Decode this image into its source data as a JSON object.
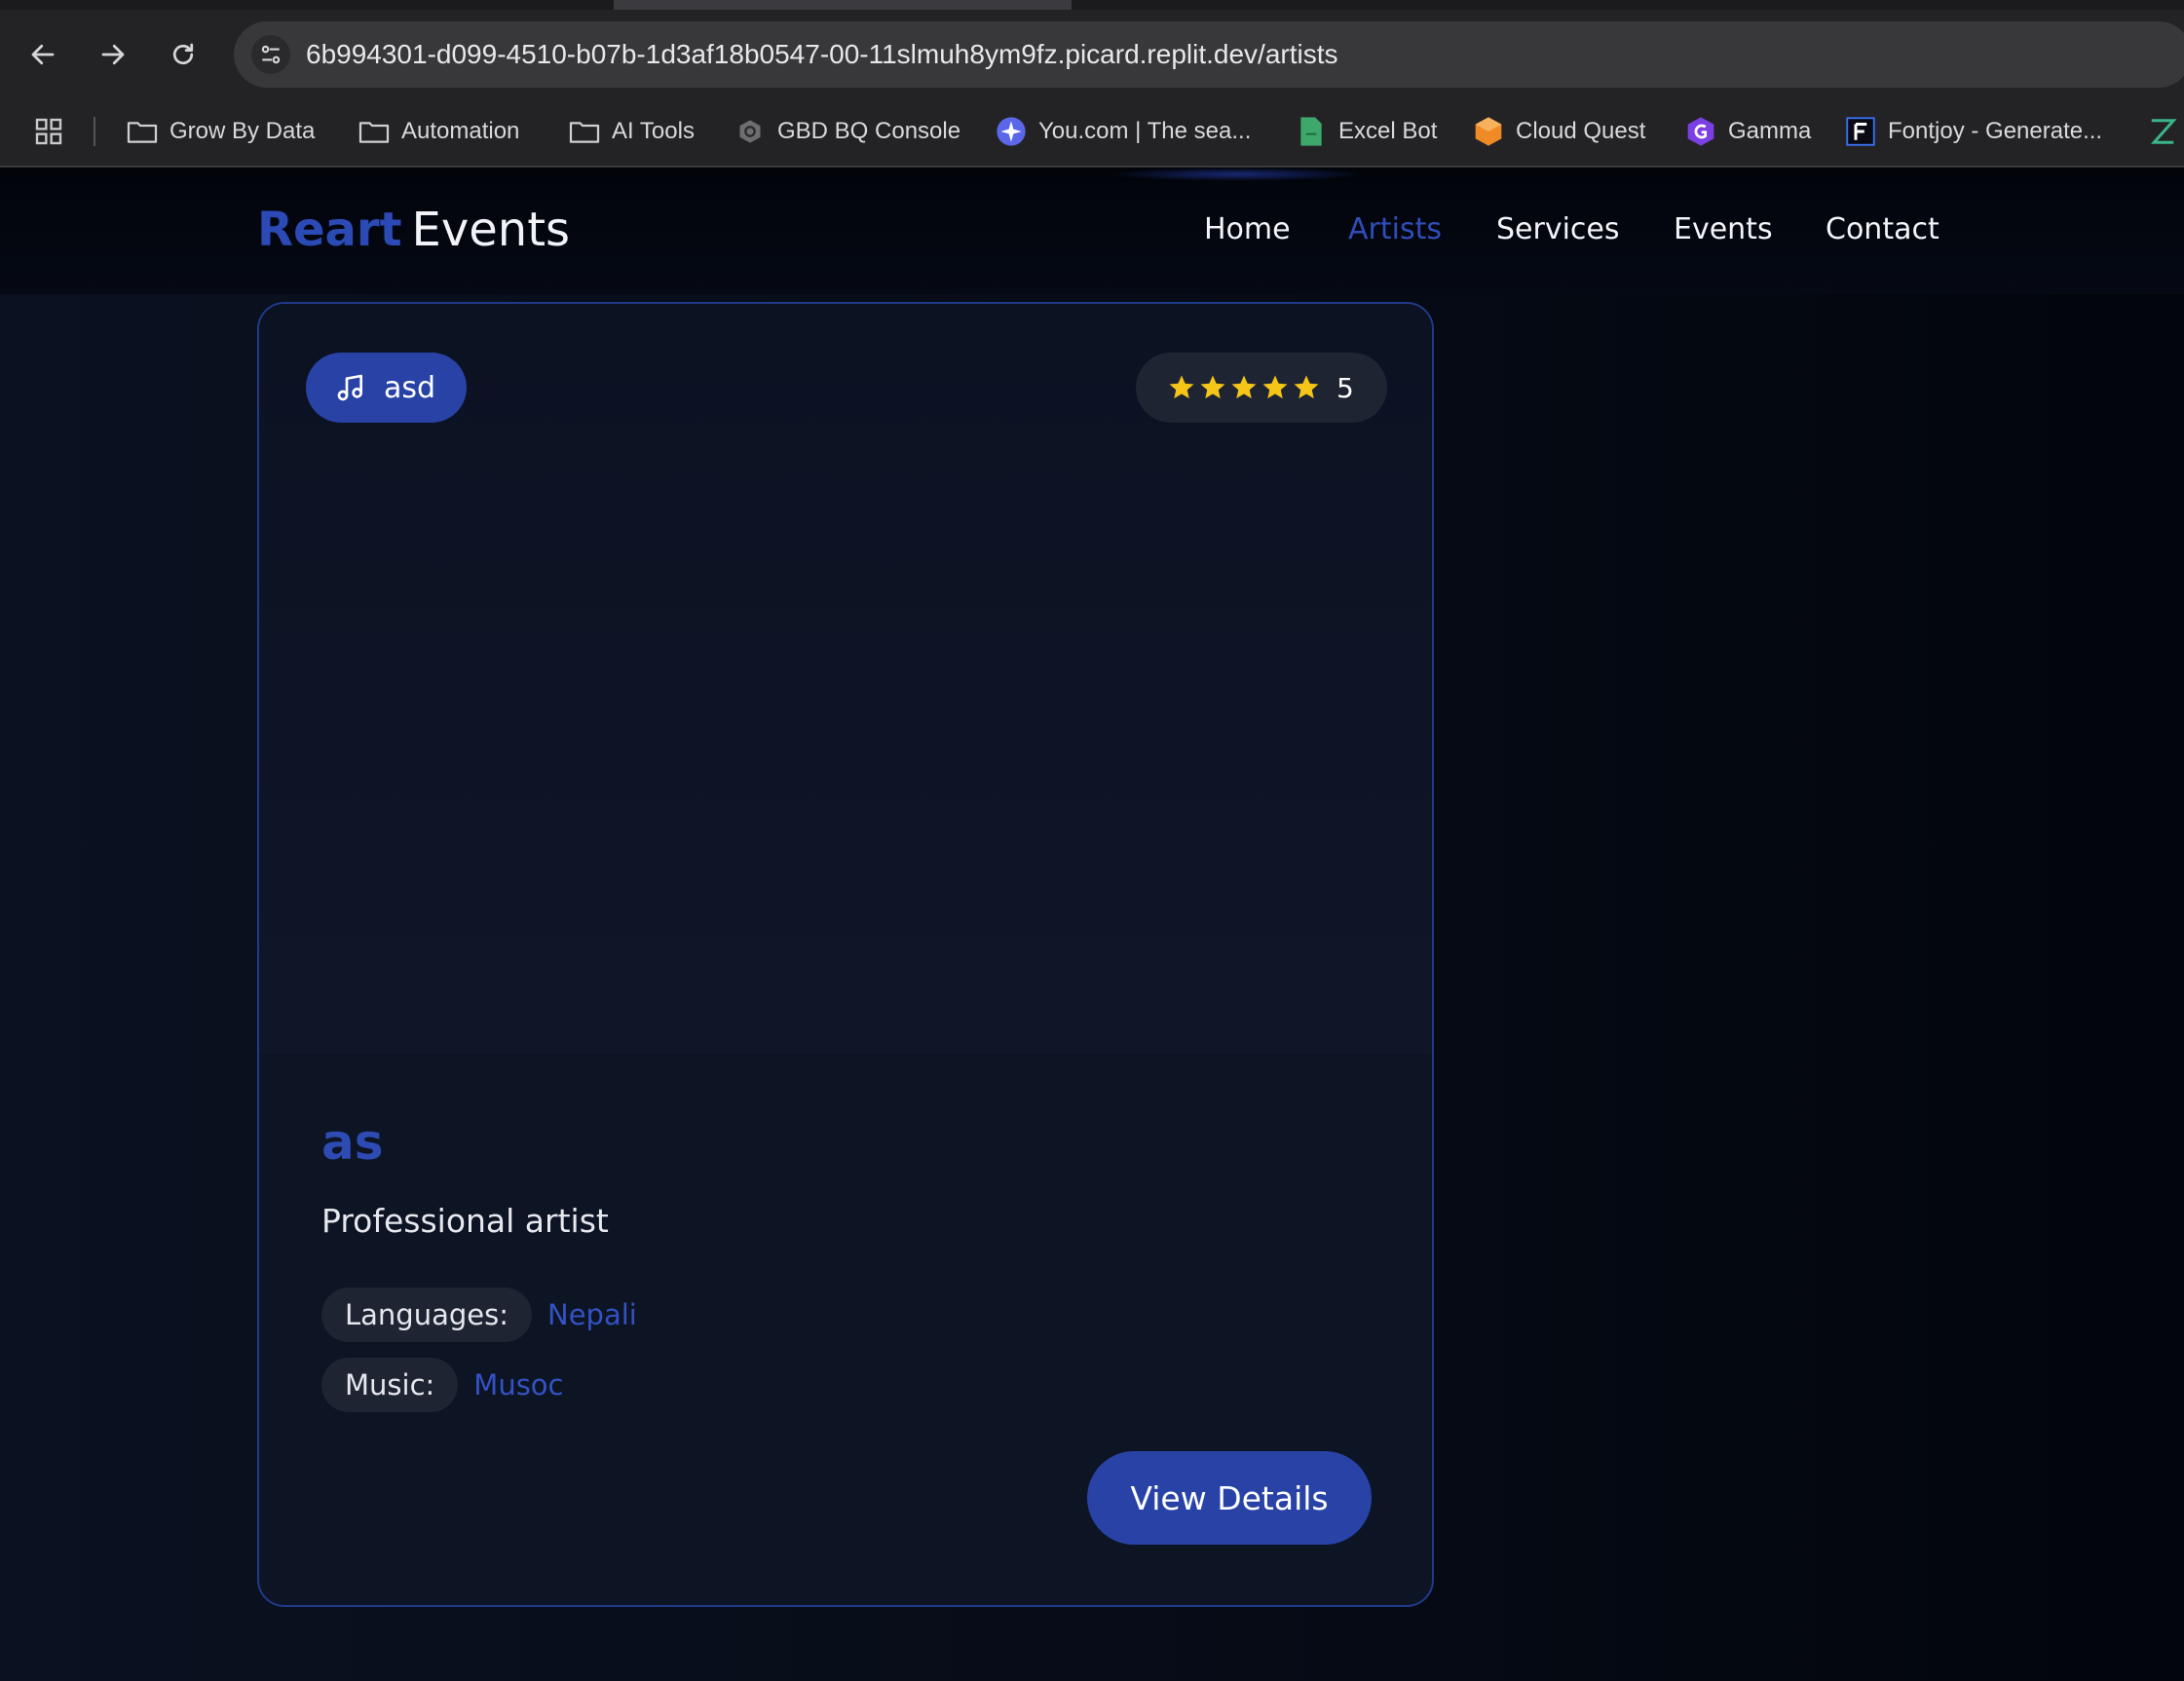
{
  "browser": {
    "url": "6b994301-d099-4510-b07b-1d3af18b0547-00-11slmuh8ym9fz.picard.replit.dev/artists",
    "bookmarks": [
      {
        "label": "Grow By Data",
        "icon": "folder-icon"
      },
      {
        "label": "Automation",
        "icon": "folder-icon"
      },
      {
        "label": "AI Tools",
        "icon": "folder-icon"
      },
      {
        "label": "GBD BQ Console",
        "icon": "bigquery-icon"
      },
      {
        "label": "You.com | The sea...",
        "icon": "you-com-icon"
      },
      {
        "label": "Excel Bot",
        "icon": "excel-bot-icon"
      },
      {
        "label": "Cloud Quest",
        "icon": "cloud-quest-icon"
      },
      {
        "label": "Gamma",
        "icon": "gamma-icon"
      },
      {
        "label": "Fontjoy - Generate...",
        "icon": "fontjoy-icon"
      }
    ]
  },
  "site": {
    "logo_brand": "Reart",
    "logo_suffix": "Events",
    "nav": [
      {
        "label": "Home",
        "active": false
      },
      {
        "label": "Artists",
        "active": true
      },
      {
        "label": "Services",
        "active": false
      },
      {
        "label": "Events",
        "active": false
      },
      {
        "label": "Contact",
        "active": false
      }
    ]
  },
  "artist_card": {
    "category": "asd",
    "category_icon": "music-note-icon",
    "rating_stars": 5,
    "rating_value": "5",
    "name": "as",
    "title": "Professional artist",
    "languages_label": "Languages:",
    "languages_value": "Nepali",
    "music_label": "Music:",
    "music_value": "Musoc",
    "cta_label": "View Details"
  },
  "colors": {
    "accent": "#2842a6",
    "accent_text": "#2f4db8",
    "star": "#f5c518",
    "background": "#03060e"
  }
}
